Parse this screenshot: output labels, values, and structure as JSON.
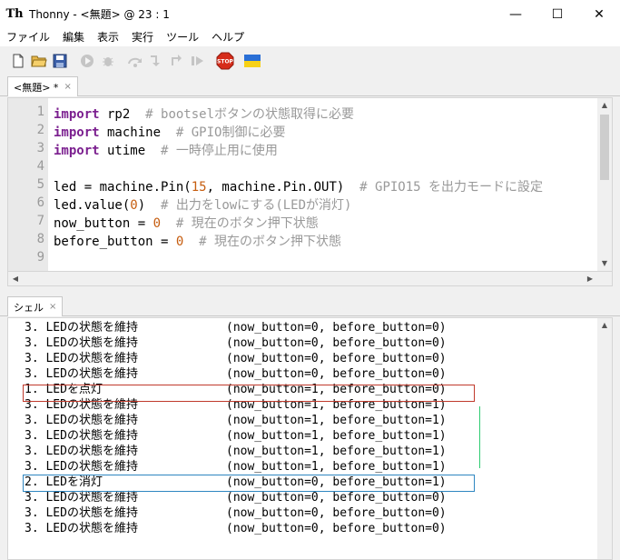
{
  "window": {
    "title": "Thonny  -  <無題>  @  23 : 1",
    "app_icon_text": "Th",
    "minimize": "—",
    "maximize": "☐",
    "close": "✕"
  },
  "menu": [
    "ファイル",
    "編集",
    "表示",
    "実行",
    "ツール",
    "ヘルプ"
  ],
  "editor": {
    "tab_label": "<無題> *",
    "tab_close": "×",
    "line_numbers": [
      "1",
      "2",
      "3",
      "4",
      "5",
      "6",
      "7",
      "8",
      "9"
    ]
  },
  "code": {
    "l1": {
      "kw": "import",
      "rest": " rp2  ",
      "cm": "# bootselボタンの状態取得に必要"
    },
    "l2": {
      "kw": "import",
      "rest": " machine  ",
      "cm": "# GPIO制御に必要"
    },
    "l3": {
      "kw": "import",
      "rest": " utime  ",
      "cm": "# 一時停止用に使用"
    },
    "l5": {
      "a": "led = machine.Pin(",
      "n": "15",
      "b": ", machine.Pin.OUT)  ",
      "cm": "# GPIO15 を出力モードに設定"
    },
    "l6": {
      "a": "led.value(",
      "n": "0",
      "b": ")  ",
      "cm": "# 出力をlowにする(LEDが消灯)"
    },
    "l7": {
      "a": "now_button = ",
      "n": "0",
      "b": "  ",
      "cm": "# 現在のボタン押下状態"
    },
    "l8": {
      "a": "before_button = ",
      "n": "0",
      "b": "  ",
      "cm": "# 現在のボタン押下状態"
    }
  },
  "shell": {
    "tab_label": "シェル",
    "tab_close": "×",
    "lines": [
      {
        "status": "3. LEDの状態を維持",
        "vals": "(now_button=0, before_button=0)"
      },
      {
        "status": "3. LEDの状態を維持",
        "vals": "(now_button=0, before_button=0)"
      },
      {
        "status": "3. LEDの状態を維持",
        "vals": "(now_button=0, before_button=0)"
      },
      {
        "status": "3. LEDの状態を維持",
        "vals": "(now_button=0, before_button=0)"
      },
      {
        "status": "1. LEDを点灯",
        "vals": "(now_button=1, before_button=0)"
      },
      {
        "status": "3. LEDの状態を維持",
        "vals": "(now_button=1, before_button=1)"
      },
      {
        "status": "3. LEDの状態を維持",
        "vals": "(now_button=1, before_button=1)"
      },
      {
        "status": "3. LEDの状態を維持",
        "vals": "(now_button=1, before_button=1)"
      },
      {
        "status": "3. LEDの状態を維持",
        "vals": "(now_button=1, before_button=1)"
      },
      {
        "status": "3. LEDの状態を維持",
        "vals": "(now_button=1, before_button=1)"
      },
      {
        "status": "2. LEDを消灯",
        "vals": "(now_button=0, before_button=1)"
      },
      {
        "status": "3. LEDの状態を維持",
        "vals": "(now_button=0, before_button=0)"
      },
      {
        "status": "3. LEDの状態を維持",
        "vals": "(now_button=0, before_button=0)"
      },
      {
        "status": "3. LEDの状態を維持",
        "vals": "(now_button=0, before_button=0)"
      }
    ]
  },
  "icons": [
    "new-file-icon",
    "open-folder-icon",
    "save-icon",
    "run-icon",
    "debug-icon",
    "step-over-icon",
    "step-into-icon",
    "step-out-icon",
    "resume-icon",
    "stop-icon",
    "ukraine-flag-icon"
  ],
  "colors": {
    "keyword": "#7b1f8f",
    "number": "#c65d0f",
    "comment": "#999999",
    "stop": "#d62c1a",
    "highlight_red": "#c0392b",
    "highlight_blue": "#2e86c1"
  },
  "stop_label": "STOP"
}
